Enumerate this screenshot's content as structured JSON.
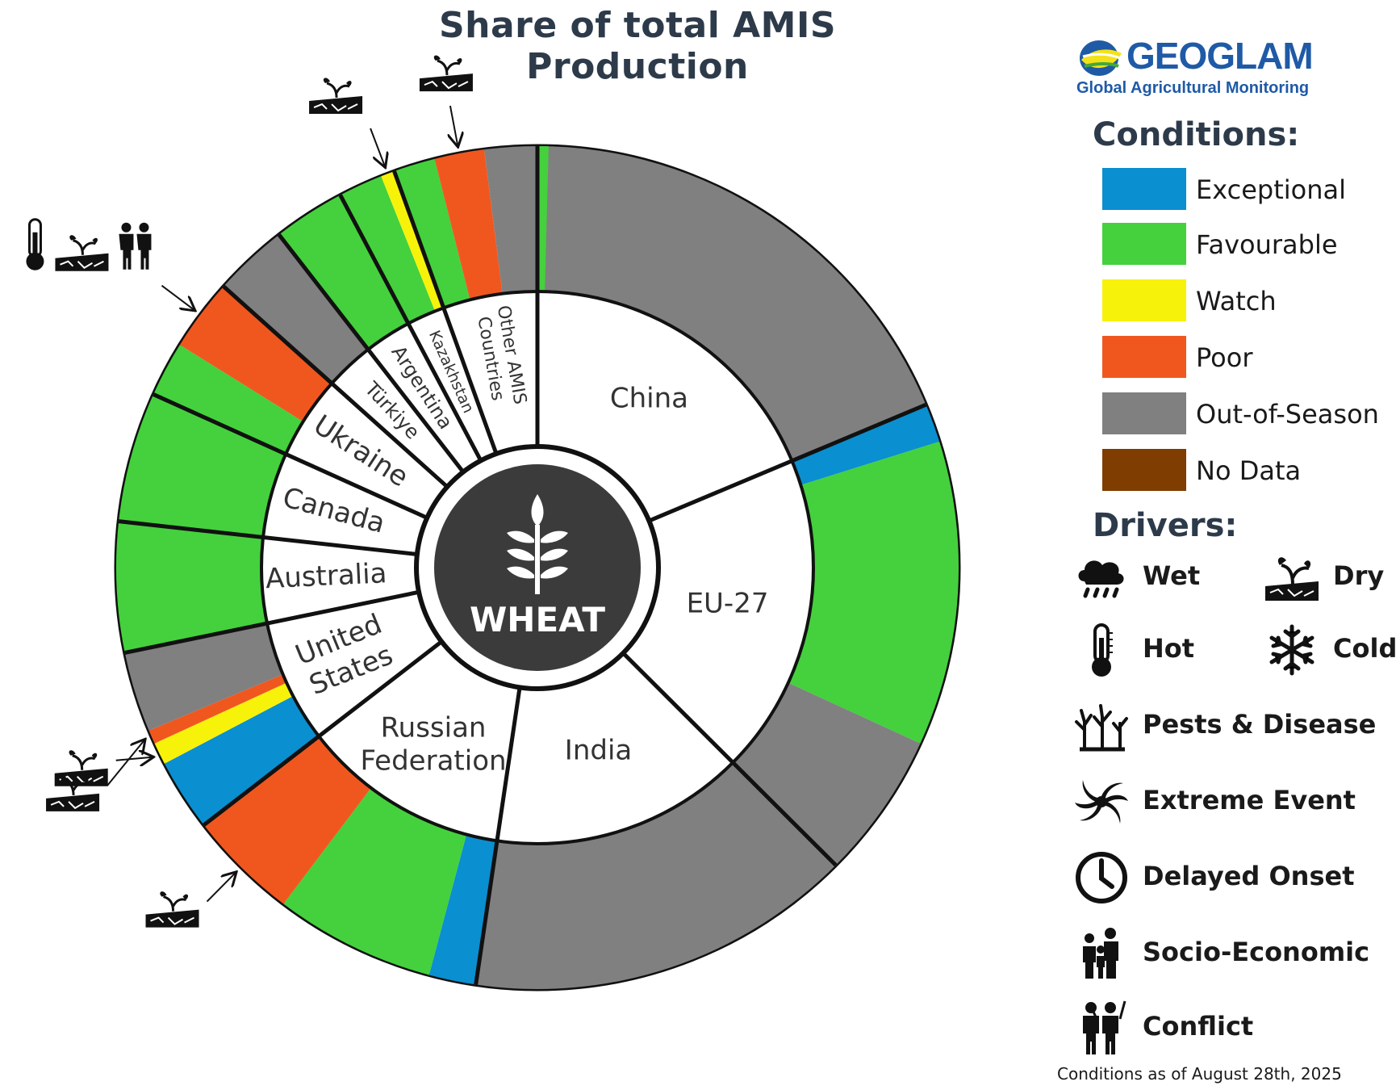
{
  "title": "Share of total AMIS Production",
  "logo": {
    "name": "GEOGLAM",
    "subtitle": "Global Agricultural Monitoring"
  },
  "legend": {
    "conditions_title": "Conditions:",
    "conditions": [
      {
        "label": "Exceptional",
        "color": "#0a8fd0"
      },
      {
        "label": "Favourable",
        "color": "#44d13d"
      },
      {
        "label": "Watch",
        "color": "#f7f20a"
      },
      {
        "label": "Poor",
        "color": "#f0571f"
      },
      {
        "label": "Out-of-Season",
        "color": "#808080"
      },
      {
        "label": "No Data",
        "color": "#7f3d02"
      }
    ],
    "drivers_title": "Drivers:",
    "drivers": [
      {
        "label": "Wet",
        "icon": "rain-cloud-icon"
      },
      {
        "label": "Dry",
        "icon": "dry-soil-icon"
      },
      {
        "label": "Hot",
        "icon": "thermometer-icon"
      },
      {
        "label": "Cold",
        "icon": "snowflake-icon"
      },
      {
        "label": "Pests & Disease",
        "icon": "pests-disease-icon"
      },
      {
        "label": "Extreme Event",
        "icon": "cyclone-icon"
      },
      {
        "label": "Delayed Onset",
        "icon": "clock-icon"
      },
      {
        "label": "Socio-Economic",
        "icon": "family-icon"
      },
      {
        "label": "Conflict",
        "icon": "soldiers-icon"
      }
    ]
  },
  "footnote": "Conditions as of August 28th, 2025",
  "chart_data": {
    "type": "pie",
    "subtype": "nested-donut",
    "center_label": "WHEAT",
    "center_icon": "wheat-icon",
    "countries": [
      {
        "label": "China",
        "share": 17.6,
        "conditions": [
          {
            "condition": "Out-of-Season",
            "share": 17.6
          }
        ]
      },
      {
        "label": "EU-27",
        "share": 17.7,
        "conditions": [
          {
            "condition": "Exceptional",
            "share": 1.4
          },
          {
            "condition": "Favourable",
            "share": 11.0
          },
          {
            "condition": "Out-of-Season",
            "share": 5.3
          }
        ]
      },
      {
        "label": "India",
        "share": 14.0,
        "conditions": [
          {
            "condition": "Out-of-Season",
            "share": 14.0
          }
        ]
      },
      {
        "label": "Russian Federation",
        "share": 11.5,
        "conditions": [
          {
            "condition": "Exceptional",
            "share": 1.7
          },
          {
            "condition": "Favourable",
            "share": 5.8
          },
          {
            "condition": "Poor",
            "share": 4.0,
            "drivers": [
              "dry-soil-icon"
            ]
          }
        ]
      },
      {
        "label": "United States",
        "share": 6.8,
        "conditions": [
          {
            "condition": "Exceptional",
            "share": 2.6
          },
          {
            "condition": "Watch",
            "share": 0.8,
            "drivers": [
              "dry-soil-icon"
            ]
          },
          {
            "condition": "Poor",
            "share": 0.5,
            "drivers": [
              "dry-soil-icon"
            ]
          },
          {
            "condition": "Out-of-Season",
            "share": 2.9
          }
        ]
      },
      {
        "label": "Australia",
        "share": 4.7,
        "conditions": [
          {
            "condition": "Favourable",
            "share": 4.7
          }
        ]
      },
      {
        "label": "Canada",
        "share": 4.7,
        "conditions": [
          {
            "condition": "Favourable",
            "share": 4.7
          }
        ]
      },
      {
        "label": "Ukraine",
        "share": 4.6,
        "conditions": [
          {
            "condition": "Favourable",
            "share": 2.0
          },
          {
            "condition": "Poor",
            "share": 2.6,
            "drivers": [
              "thermometer-icon",
              "dry-soil-icon",
              "soldiers-icon"
            ]
          }
        ]
      },
      {
        "label": "Türkiye",
        "share": 2.7,
        "conditions": [
          {
            "condition": "Out-of-Season",
            "share": 2.7
          }
        ]
      },
      {
        "label": "Argentina",
        "share": 2.6,
        "conditions": [
          {
            "condition": "Favourable",
            "share": 2.6
          }
        ]
      },
      {
        "label": "Kazakhstan",
        "share": 2.1,
        "conditions": [
          {
            "condition": "Favourable",
            "share": 1.6
          },
          {
            "condition": "Watch",
            "share": 0.5,
            "drivers": [
              "dry-soil-icon"
            ]
          }
        ]
      },
      {
        "label": "Other AMIS Countries",
        "share": 5.2,
        "conditions": [
          {
            "condition": "Favourable",
            "share": 1.5
          },
          {
            "condition": "Poor",
            "share": 1.8,
            "drivers": [
              "dry-soil-icon"
            ]
          },
          {
            "condition": "Out-of-Season",
            "share": 1.9
          },
          {
            "condition": "Favourable",
            "share": 0.4
          }
        ]
      }
    ]
  }
}
